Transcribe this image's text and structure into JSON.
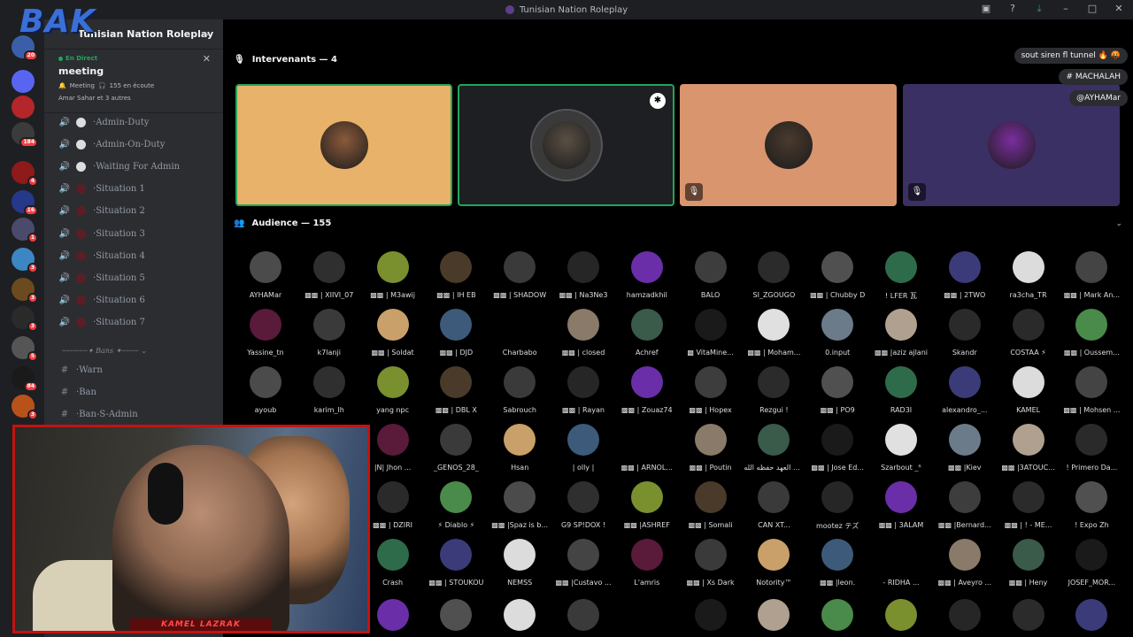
{
  "window": {
    "title": "Tunisian Nation Roleplay"
  },
  "brand": {
    "overlay_text": "BAK"
  },
  "server": {
    "name": "Tunisian Nation Roleplay"
  },
  "live": {
    "status": "En Direct",
    "stage_name": "meeting",
    "category": "Meeting",
    "listeners": "155 en écoute",
    "attendees": "Amar Sahar et 3 autres"
  },
  "guilds": [
    {
      "badge": "20",
      "color": "#3a5fa8"
    },
    {
      "badge": "",
      "color": "#5865f2"
    },
    {
      "badge": "",
      "color": "#b3262a"
    },
    {
      "badge": "184",
      "color": "#3b3b3b"
    },
    {
      "badge": "4",
      "color": "#8e1a1a"
    },
    {
      "badge": "16",
      "color": "#25388a"
    },
    {
      "badge": "1",
      "color": "#4a4a6a"
    },
    {
      "badge": "3",
      "color": "#3d86c4"
    },
    {
      "badge": "3",
      "color": "#6b4a1f"
    },
    {
      "badge": "3",
      "color": "#2a2a2a"
    },
    {
      "badge": "5",
      "color": "#555555"
    },
    {
      "badge": "84",
      "color": "#1a1a1a"
    },
    {
      "badge": "3",
      "color": "#b8521b"
    }
  ],
  "channels": [
    {
      "name": "Admin-Duty",
      "icon": "clock-icon"
    },
    {
      "name": "Admin-On-Duty",
      "icon": "clock-icon"
    },
    {
      "name": "Waiting For Admin",
      "icon": "clock-icon"
    },
    {
      "name": "Situation 1",
      "icon": "gear-icon"
    },
    {
      "name": "Situation 2",
      "icon": "gear-icon"
    },
    {
      "name": "Situation 3",
      "icon": "gear-icon"
    },
    {
      "name": "Situation 4",
      "icon": "gear-icon"
    },
    {
      "name": "Situation 5",
      "icon": "gear-icon"
    },
    {
      "name": "Situation 6",
      "icon": "gear-icon"
    },
    {
      "name": "Situation 7",
      "icon": "gear-icon"
    }
  ],
  "category": {
    "name": "Bans"
  },
  "text_channels": [
    {
      "name": "Warn"
    },
    {
      "name": "Ban"
    },
    {
      "name": "Ban-S-Admin"
    }
  ],
  "stage": {
    "speakers_header": "Intervenants — 4",
    "audience_header": "Audience — 155"
  },
  "speakers": [
    {
      "bg": "#e9b26a",
      "avatar": "#8a5a3a",
      "muted": false,
      "badge": false,
      "active": true
    },
    {
      "bg": "#1e1f22",
      "avatar": "#5a4f45",
      "muted": false,
      "badge": true,
      "active": true
    },
    {
      "bg": "#d9956e",
      "avatar": "#4a3a2e",
      "muted": true,
      "badge": false,
      "active": false
    },
    {
      "bg": "#3b3064",
      "avatar": "#7a2e9e",
      "muted": true,
      "badge": false,
      "active": false
    }
  ],
  "chat_overlay": {
    "msg1": "sout siren fl tunnel 🔥 🤬",
    "msg2": "# MACHALAH",
    "msg3": "@AYHAMar"
  },
  "audience": [
    [
      "AYHAMar",
      "▩▩ | XIIVI_07",
      "▩▩ | M3awij",
      "▩▩ | IH EB",
      "▩▩ | SHADOW",
      "▩▩ | Na3Ne3",
      "hamzadkhil",
      "BALO",
      "SI_ZGOUGO",
      "▩▩ | Chubby D",
      "! LFER 瓦",
      "▩▩ | 2TWO",
      "ra3cha_TR",
      "▩▩ | Mark An..."
    ],
    [
      "Yassine_tn",
      "k7lanji",
      "▩▩ | Soldat",
      "▩▩ | DJD",
      "Charbabo",
      "▩▩ | closed",
      "Achref",
      "▩ VitaMine...",
      "▩▩ | Moham...",
      "0.input",
      "▩▩ |aziz ajlani",
      "Skandr",
      "COSTAA ⚡",
      "▩▩ | Oussem..."
    ],
    [
      "ayoub",
      "karim_lh",
      "yang npc",
      "▩▩ | DBL X",
      "Sabrouch",
      "▩▩ | Rayan",
      "▩▩ | Zouaz74",
      "▩▩ | Hopex",
      "Rezgui !",
      "▩▩ | PO9",
      "RAD3I",
      "alexandro_...",
      "KAMEL",
      "▩▩ | Mohsen ..."
    ],
    [
      "|N| Jhon ...",
      "_GENOS_28_",
      "Hsan",
      "| olly |",
      "▩▩ | ARNOL...",
      "▩▩ | Poutin",
      "ولي العهد حفظه الله",
      "▩▩ | Jose Ed...",
      "Szarbout _ᴿ",
      "▩▩ |Kiev",
      "▩▩ |3ATOUC...",
      "! Primero Da..."
    ],
    [
      "▩▩ | DZIRI",
      "⚡ Diablo ⚡",
      "▩▩ |Spaz is b...",
      "G9 SP!DOX !",
      "▩▩ |ASHREF",
      "▩▩ | Somali",
      "CAN XT...",
      "mootez テズ",
      "▩▩ | 3ALAM",
      "▩▩ |Bernard...",
      "▩▩ | ! - ME...",
      "! Expo Zh"
    ],
    [
      "Crash",
      "▩▩ | STOUKOU",
      "NEMSS",
      "▩▩ |Custavo ...",
      "L'amris",
      "▩▩ | Xs Dark",
      "Notority™",
      "▩▩ |leon.",
      "- RIDHA ...",
      "▩▩ | Aveyro ...",
      "▩▩ | Heny",
      "JOSEF_MOR..."
    ]
  ],
  "audience_colors": [
    "#4b4b4b",
    "#2f2f2f",
    "#7a8f2e",
    "#4a3a2a",
    "#3a3a3a",
    "#262626",
    "#6a2ea8",
    "#3d3d3d",
    "#2b2b2b",
    "#505050",
    "#2e6b4a",
    "#3b3b7a",
    "#dcdcdc",
    "#444444",
    "#5a1a3a",
    "#3a3a3a",
    "#c9a06a",
    "#3d5a7a",
    "#000000",
    "#8a7a6a",
    "#3a5a4a",
    "#1a1a1a",
    "#e0e0e0",
    "#6b7b8a",
    "#b0a090",
    "#2a2a2a",
    "#2a2a2a",
    "#4a8a4a"
  ],
  "webcam": {
    "name_tag": "KAMEL LAZRAK"
  }
}
